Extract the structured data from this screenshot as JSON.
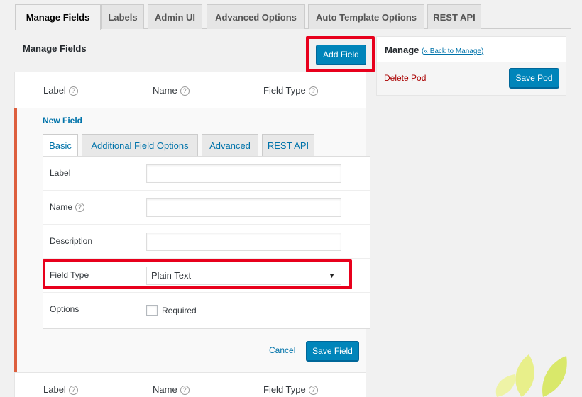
{
  "top_tabs": [
    "Manage Fields",
    "Labels",
    "Admin UI",
    "Advanced Options",
    "Auto Template Options",
    "REST API"
  ],
  "panel": {
    "title": "Manage Fields",
    "add_field_label": "Add Field"
  },
  "columns": {
    "label": "Label",
    "name": "Name",
    "field_type": "Field Type"
  },
  "field": {
    "title": "New Field",
    "tabs": [
      "Basic",
      "Additional Field Options",
      "Advanced",
      "REST API"
    ],
    "rows": {
      "label": "Label",
      "name": "Name",
      "description": "Description",
      "field_type": "Field Type",
      "options": "Options"
    },
    "field_type_value": "Plain Text",
    "required_label": "Required",
    "cancel_label": "Cancel",
    "save_label": "Save Field"
  },
  "side": {
    "title": "Manage",
    "back_link": "(« Back to Manage)",
    "delete_label": "Delete Pod",
    "save_label": "Save Pod"
  },
  "help_glyph": "?",
  "colors": {
    "primary": "#0085ba",
    "highlight": "#e8001c",
    "accent": "#dd5f3e",
    "link": "#0073aa",
    "delete": "#aa0000"
  }
}
